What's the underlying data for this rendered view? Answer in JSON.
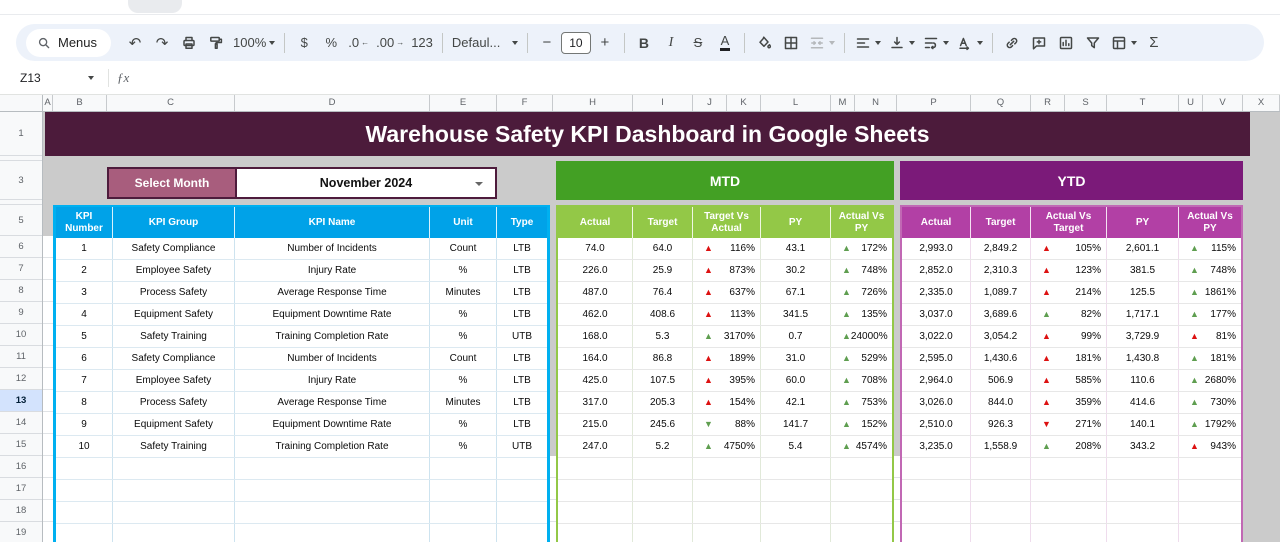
{
  "toolbar": {
    "menus_label": "Menus",
    "undo": "↶",
    "redo": "↷",
    "zoom_value": "100%",
    "currency": "$",
    "percent": "%",
    "dec_decrease": ".0",
    "dec_decrease_arrow": "←",
    "dec_increase": ".00",
    "dec_increase_arrow": "→",
    "more_formats": "123",
    "font_name": "Defaul...",
    "decrease_size": "−",
    "font_size": "10",
    "increase_size": "+",
    "bold": "B",
    "italic": "I",
    "strikethrough": "S",
    "text_color": "A",
    "functions": "Σ"
  },
  "formula_bar": {
    "name_box": "Z13",
    "fx_label": "ƒx"
  },
  "sheet": {
    "columns": [
      "A",
      "B",
      "C",
      "D",
      "E",
      "F",
      "H",
      "I",
      "J",
      "K",
      "L",
      "M",
      "N",
      "P",
      "Q",
      "R",
      "S",
      "T",
      "U",
      "V",
      "X"
    ],
    "row_labels": [
      "1",
      "",
      "3",
      "",
      "5",
      "6",
      "7",
      "8",
      "9",
      "10",
      "11",
      "12",
      "13",
      "14",
      "15",
      "16",
      "17",
      "18",
      "19"
    ],
    "selected_row_label": "13",
    "title": "Warehouse Safety KPI Dashboard in Google Sheets",
    "select_month": {
      "label": "Select Month",
      "value": "November 2024"
    },
    "kpi_table": {
      "headers": [
        "KPI Number",
        "KPI Group",
        "KPI Name",
        "Unit",
        "Type"
      ],
      "rows": [
        {
          "number": "1",
          "group": "Safety Compliance",
          "name": "Number of Incidents",
          "unit": "Count",
          "type": "LTB"
        },
        {
          "number": "2",
          "group": "Employee Safety",
          "name": "Injury Rate",
          "unit": "%",
          "type": "LTB"
        },
        {
          "number": "3",
          "group": "Process Safety",
          "name": "Average Response Time",
          "unit": "Minutes",
          "type": "LTB"
        },
        {
          "number": "4",
          "group": "Equipment Safety",
          "name": "Equipment Downtime Rate",
          "unit": "%",
          "type": "LTB"
        },
        {
          "number": "5",
          "group": "Safety Training",
          "name": "Training Completion Rate",
          "unit": "%",
          "type": "UTB"
        },
        {
          "number": "6",
          "group": "Safety Compliance",
          "name": "Number of Incidents",
          "unit": "Count",
          "type": "LTB"
        },
        {
          "number": "7",
          "group": "Employee Safety",
          "name": "Injury Rate",
          "unit": "%",
          "type": "LTB"
        },
        {
          "number": "8",
          "group": "Process Safety",
          "name": "Average Response Time",
          "unit": "Minutes",
          "type": "LTB"
        },
        {
          "number": "9",
          "group": "Equipment Safety",
          "name": "Equipment Downtime Rate",
          "unit": "%",
          "type": "LTB"
        },
        {
          "number": "10",
          "group": "Safety Training",
          "name": "Training Completion Rate",
          "unit": "%",
          "type": "UTB"
        }
      ]
    },
    "mtd": {
      "banner": "MTD",
      "headers": [
        "Actual",
        "Target",
        "Target Vs Actual",
        "PY",
        "Actual Vs PY"
      ],
      "rows": [
        {
          "actual": "74.0",
          "target": "64.0",
          "tva": {
            "dir": "up",
            "tone": "bad",
            "value": "116%"
          },
          "py": "43.1",
          "avpy": {
            "dir": "up",
            "tone": "good",
            "value": "172%"
          }
        },
        {
          "actual": "226.0",
          "target": "25.9",
          "tva": {
            "dir": "up",
            "tone": "bad",
            "value": "873%"
          },
          "py": "30.2",
          "avpy": {
            "dir": "up",
            "tone": "good",
            "value": "748%"
          }
        },
        {
          "actual": "487.0",
          "target": "76.4",
          "tva": {
            "dir": "up",
            "tone": "bad",
            "value": "637%"
          },
          "py": "67.1",
          "avpy": {
            "dir": "up",
            "tone": "good",
            "value": "726%"
          }
        },
        {
          "actual": "462.0",
          "target": "408.6",
          "tva": {
            "dir": "up",
            "tone": "bad",
            "value": "113%"
          },
          "py": "341.5",
          "avpy": {
            "dir": "up",
            "tone": "good",
            "value": "135%"
          }
        },
        {
          "actual": "168.0",
          "target": "5.3",
          "tva": {
            "dir": "up",
            "tone": "good",
            "value": "3170%"
          },
          "py": "0.7",
          "avpy": {
            "dir": "up",
            "tone": "good",
            "value": "24000%"
          }
        },
        {
          "actual": "164.0",
          "target": "86.8",
          "tva": {
            "dir": "up",
            "tone": "bad",
            "value": "189%"
          },
          "py": "31.0",
          "avpy": {
            "dir": "up",
            "tone": "good",
            "value": "529%"
          }
        },
        {
          "actual": "425.0",
          "target": "107.5",
          "tva": {
            "dir": "up",
            "tone": "bad",
            "value": "395%"
          },
          "py": "60.0",
          "avpy": {
            "dir": "up",
            "tone": "good",
            "value": "708%"
          }
        },
        {
          "actual": "317.0",
          "target": "205.3",
          "tva": {
            "dir": "up",
            "tone": "bad",
            "value": "154%"
          },
          "py": "42.1",
          "avpy": {
            "dir": "up",
            "tone": "good",
            "value": "753%"
          }
        },
        {
          "actual": "215.0",
          "target": "245.6",
          "tva": {
            "dir": "down",
            "tone": "good",
            "value": "88%"
          },
          "py": "141.7",
          "avpy": {
            "dir": "up",
            "tone": "good",
            "value": "152%"
          }
        },
        {
          "actual": "247.0",
          "target": "5.2",
          "tva": {
            "dir": "up",
            "tone": "good",
            "value": "4750%"
          },
          "py": "5.4",
          "avpy": {
            "dir": "up",
            "tone": "good",
            "value": "4574%"
          }
        }
      ]
    },
    "ytd": {
      "banner": "YTD",
      "headers": [
        "Actual",
        "Target",
        "Actual Vs Target",
        "PY",
        "Actual Vs PY"
      ],
      "rows": [
        {
          "actual": "2,993.0",
          "target": "2,849.2",
          "avt": {
            "dir": "up",
            "tone": "bad",
            "value": "105%"
          },
          "py": "2,601.1",
          "avpy": {
            "dir": "up",
            "tone": "good",
            "value": "115%"
          }
        },
        {
          "actual": "2,852.0",
          "target": "2,310.3",
          "avt": {
            "dir": "up",
            "tone": "bad",
            "value": "123%"
          },
          "py": "381.5",
          "avpy": {
            "dir": "up",
            "tone": "good",
            "value": "748%"
          }
        },
        {
          "actual": "2,335.0",
          "target": "1,089.7",
          "avt": {
            "dir": "up",
            "tone": "bad",
            "value": "214%"
          },
          "py": "125.5",
          "avpy": {
            "dir": "up",
            "tone": "good",
            "value": "1861%"
          }
        },
        {
          "actual": "3,037.0",
          "target": "3,689.6",
          "avt": {
            "dir": "up",
            "tone": "good",
            "value": "82%"
          },
          "py": "1,717.1",
          "avpy": {
            "dir": "up",
            "tone": "good",
            "value": "177%"
          }
        },
        {
          "actual": "3,022.0",
          "target": "3,054.2",
          "avt": {
            "dir": "up",
            "tone": "bad",
            "value": "99%"
          },
          "py": "3,729.9",
          "avpy": {
            "dir": "up",
            "tone": "bad",
            "value": "81%"
          }
        },
        {
          "actual": "2,595.0",
          "target": "1,430.6",
          "avt": {
            "dir": "up",
            "tone": "bad",
            "value": "181%"
          },
          "py": "1,430.8",
          "avpy": {
            "dir": "up",
            "tone": "good",
            "value": "181%"
          }
        },
        {
          "actual": "2,964.0",
          "target": "506.9",
          "avt": {
            "dir": "up",
            "tone": "bad",
            "value": "585%"
          },
          "py": "110.6",
          "avpy": {
            "dir": "up",
            "tone": "good",
            "value": "2680%"
          }
        },
        {
          "actual": "3,026.0",
          "target": "844.0",
          "avt": {
            "dir": "up",
            "tone": "bad",
            "value": "359%"
          },
          "py": "414.6",
          "avpy": {
            "dir": "up",
            "tone": "good",
            "value": "730%"
          }
        },
        {
          "actual": "2,510.0",
          "target": "926.3",
          "avt": {
            "dir": "down",
            "tone": "bad",
            "value": "271%"
          },
          "py": "140.1",
          "avpy": {
            "dir": "up",
            "tone": "good",
            "value": "1792%"
          }
        },
        {
          "actual": "3,235.0",
          "target": "1,558.9",
          "avt": {
            "dir": "up",
            "tone": "good",
            "value": "208%"
          },
          "py": "343.2",
          "avpy": {
            "dir": "up",
            "tone": "bad",
            "value": "943%"
          }
        }
      ]
    }
  },
  "colors": {
    "title_bg": "#4c1b3b",
    "select_label_bg": "#a85d7d",
    "select_border": "#4e1b3c",
    "kpi_header_bg": "#00a2e8",
    "kpi_border": "#00b0f0",
    "mtd_banner_bg": "#43a024",
    "mtd_header_bg": "#93c847",
    "ytd_banner_bg": "#7b1a79",
    "ytd_header_bg": "#b240a5",
    "arrow_red": "#dd1111",
    "arrow_green": "#5f9e50"
  }
}
